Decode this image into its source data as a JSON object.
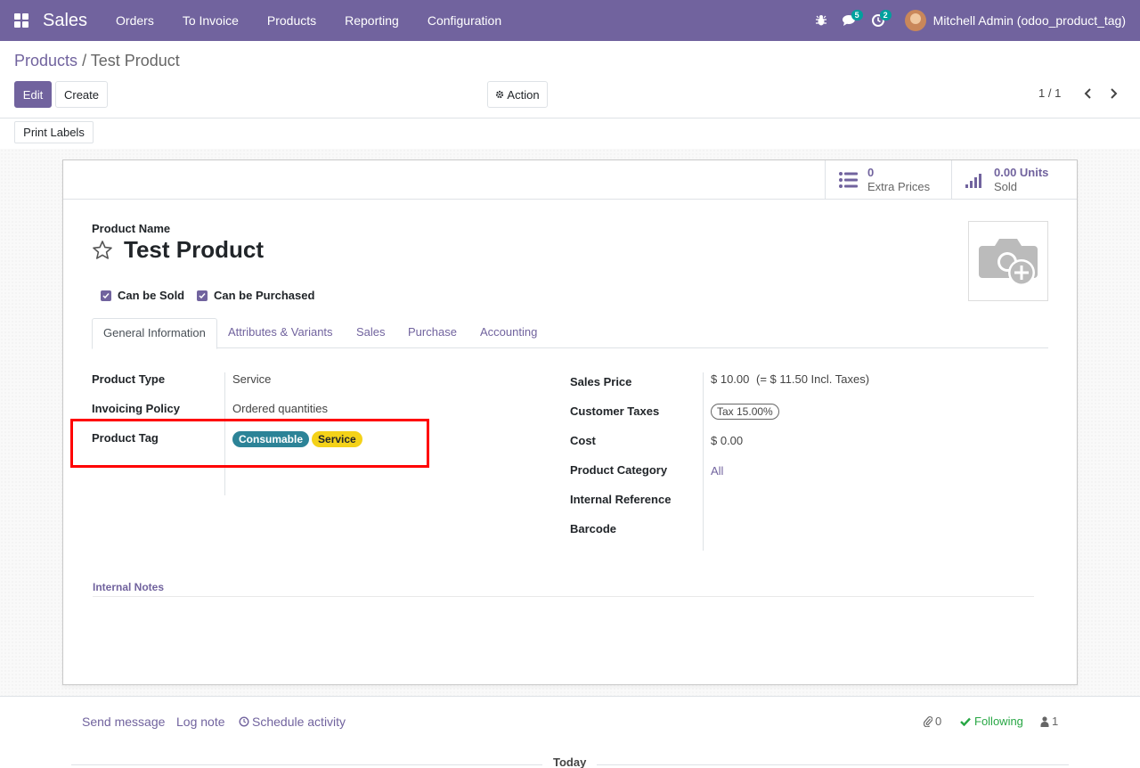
{
  "navbar": {
    "app_name": "Sales",
    "menu": [
      "Orders",
      "To Invoice",
      "Products",
      "Reporting",
      "Configuration"
    ],
    "messages_count": "5",
    "activities_count": "2",
    "user_name": "Mitchell Admin (odoo_product_tag)"
  },
  "breadcrumb": {
    "parent": "Products",
    "separator": "/",
    "current": "Test Product"
  },
  "buttons": {
    "edit": "Edit",
    "create": "Create",
    "action": "Action",
    "print_labels": "Print Labels"
  },
  "pager": {
    "value": "1 / 1"
  },
  "stat_buttons": {
    "extra_prices_value": "0",
    "extra_prices_label": "Extra Prices",
    "sold_value": "0.00 Units",
    "sold_label": "Sold"
  },
  "product": {
    "name_label": "Product Name",
    "name": "Test Product",
    "can_be_sold": "Can be Sold",
    "can_be_purchased": "Can be Purchased"
  },
  "tabs": [
    "General Information",
    "Attributes & Variants",
    "Sales",
    "Purchase",
    "Accounting"
  ],
  "left_fields": {
    "product_type_label": "Product Type",
    "product_type": "Service",
    "invoicing_policy_label": "Invoicing Policy",
    "invoicing_policy": "Ordered quantities",
    "product_tag_label": "Product Tag",
    "tags": [
      {
        "label": "Consumable",
        "color": "#2c8397"
      },
      {
        "label": "Service",
        "color": "#f4d219"
      }
    ]
  },
  "right_fields": {
    "sales_price_label": "Sales Price",
    "sales_price": "$ 10.00",
    "sales_price_incl": "(= $ 11.50 Incl. Taxes)",
    "customer_taxes_label": "Customer Taxes",
    "customer_tax": "Tax 15.00%",
    "cost_label": "Cost",
    "cost": "$ 0.00",
    "category_label": "Product Category",
    "category": "All",
    "internal_ref_label": "Internal Reference",
    "barcode_label": "Barcode"
  },
  "notes": {
    "label": "Internal Notes"
  },
  "chatter": {
    "send_message": "Send message",
    "log_note": "Log note",
    "schedule_activity": "Schedule activity",
    "attachments": "0",
    "following": "Following",
    "followers": "1",
    "today": "Today"
  },
  "colors": {
    "brand": "#71639e",
    "highlight": "#ff0000"
  }
}
